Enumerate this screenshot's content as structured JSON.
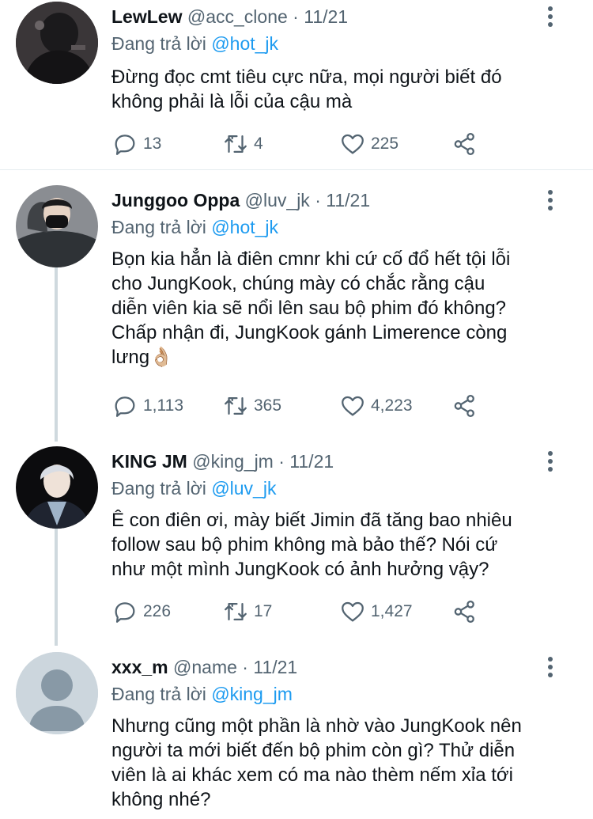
{
  "tweets": [
    {
      "name": "LewLew",
      "handle": "@acc_clone",
      "sep": "·",
      "time": "11/21",
      "reply_prefix": "Đang trả lời",
      "reply_to": "@hot_jk",
      "lines": [
        "Đừng đọc cmt tiêu cực nữa, mọi người biết đó",
        "không phải là lỗi của cậu mà"
      ],
      "replies": "13",
      "retweets": "4",
      "likes": "225",
      "avatar_icon": "dark-portrait-photo"
    },
    {
      "name": "Junggoo Oppa",
      "handle": "@luv_jk",
      "sep": "·",
      "time": "11/21",
      "reply_prefix": "Đang trả lời",
      "reply_to": "@hot_jk",
      "lines": [
        "Bọn kia hẳn là điên cmnr khi cứ cố đổ hết tội lỗi",
        "cho JungKook, chúng mày có chắc rằng cậu",
        "diễn viên kia sẽ nổi lên sau bộ phim đó không?",
        "Chấp nhận đi, JungKook gánh Limerence còng",
        "lưng👌🏼"
      ],
      "replies": "1,113",
      "retweets": "365",
      "likes": "4,223",
      "avatar_icon": "masked-person-photo"
    },
    {
      "name": "KING JM",
      "handle": "@king_jm",
      "sep": "·",
      "time": "11/21",
      "reply_prefix": "Đang trả lời",
      "reply_to": "@luv_jk",
      "lines": [
        "Ê con điên ơi, mày biết Jimin đã tăng bao nhiêu",
        "follow sau bộ phim không mà bảo thế? Nói cứ",
        "như một mình JungKook có ảnh hưởng vậy?"
      ],
      "replies": "226",
      "retweets": "17",
      "likes": "1,427",
      "avatar_icon": "silver-hair-person-photo"
    },
    {
      "name": "xxx_m",
      "handle": "@name",
      "sep": "·",
      "time": "11/21",
      "reply_prefix": "Đang trả lời",
      "reply_to": "@king_jm",
      "lines": [
        "Nhưng cũng một phần là nhờ vào JungKook nên",
        "người ta mới biết đến bộ phim còn gì? Thử diễn",
        "viên là ai khác xem có ma nào thèm nếm xỉa tới",
        "không nhé?"
      ],
      "avatar_icon": "default-profile-icon"
    }
  ],
  "colors": {
    "link": "#1d9bf0",
    "secondary": "#536471",
    "thread_line": "#cfd9de"
  }
}
